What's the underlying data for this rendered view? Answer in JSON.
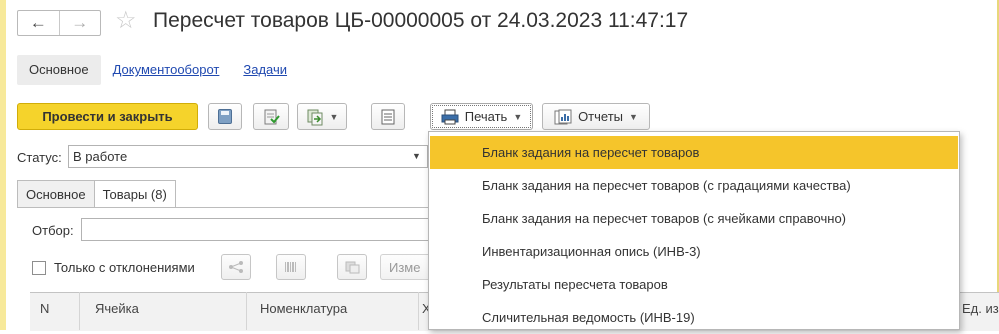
{
  "window": {
    "title": "Пересчет товаров ЦБ-00000005 от 24.03.2023 11:47:17",
    "nav_back": "←",
    "nav_forward": "→",
    "favorite_glyph": "☆"
  },
  "top_tabs": [
    {
      "label": "Основное"
    },
    {
      "label": "Документооборот"
    },
    {
      "label": "Задачи"
    }
  ],
  "toolbar": {
    "post_close_label": "Провести и закрыть",
    "print_label": "Печать",
    "reports_label": "Отчеты"
  },
  "status": {
    "label": "Статус:",
    "value": "В работе"
  },
  "inner_tabs": [
    {
      "label": "Основное"
    },
    {
      "label": "Товары (8)"
    }
  ],
  "filter": {
    "label": "Отбор:",
    "value": ""
  },
  "options": {
    "only_deviations_label": "Только с отклонениями",
    "truncated_button": "Изме"
  },
  "table": {
    "columns": [
      "N",
      "Ячейка",
      "Номенклатура",
      "Х",
      "Ед. изм"
    ]
  },
  "print_menu": {
    "items": [
      "Бланк задания на пересчет товаров",
      "Бланк задания на пересчет товаров (с градациями качества)",
      "Бланк задания на пересчет товаров (с ячейками справочно)",
      "Инвентаризационная опись (ИНВ-3)",
      "Результаты пересчета товаров",
      "Сличительная ведомость (ИНВ-19)"
    ],
    "highlighted_index": 0
  },
  "colors": {
    "accent_yellow": "#f5d32b",
    "highlight": "#f5c52b",
    "link": "#2049b0"
  }
}
